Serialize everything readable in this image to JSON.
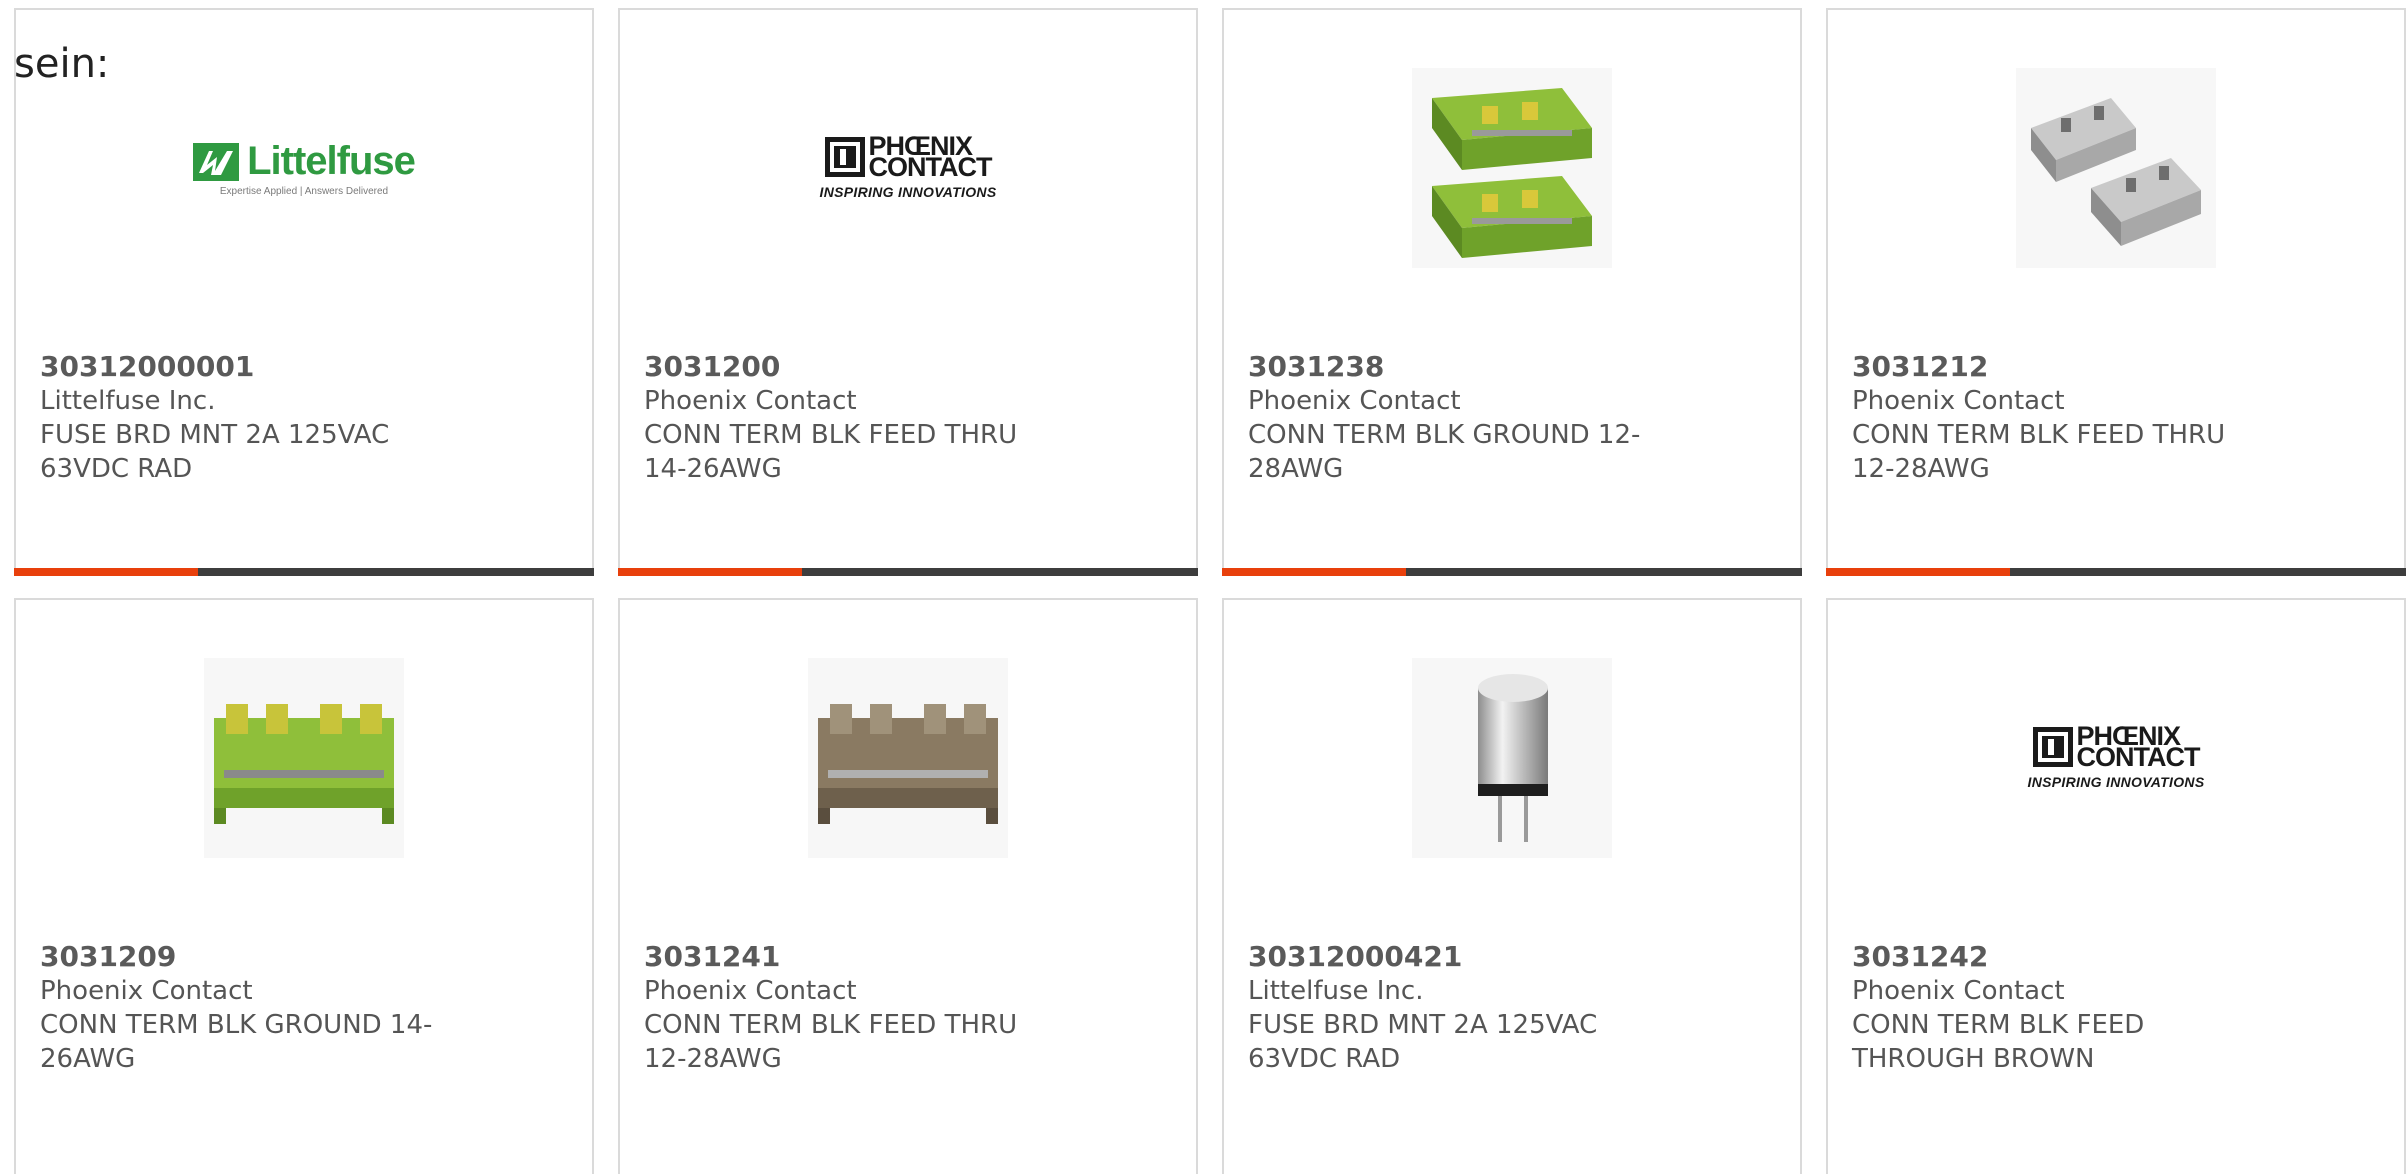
{
  "intro_text": "sein:",
  "colors": {
    "card_border": "#dadada",
    "bar_dark": "#3d3d3d",
    "bar_accent": "#e8400c",
    "littelfuse_green": "#2f9a41",
    "phoenix_black": "#1a1a1a"
  },
  "logos": {
    "littelfuse": {
      "name": "Littelfuse",
      "tagline": "Expertise Applied | Answers Delivered"
    },
    "phoenix": {
      "line1": "PHŒNIX",
      "line2": "CONTACT",
      "tagline": "INSPIRING INNOVATIONS"
    }
  },
  "products": [
    {
      "part_number": "30312000001",
      "manufacturer": "Littelfuse Inc.",
      "description": "FUSE BRD MNT 2A 125VAC 63VDC RAD",
      "image": "littelfuse-logo"
    },
    {
      "part_number": "3031200",
      "manufacturer": "Phoenix Contact",
      "description": "CONN TERM BLK FEED THRU 14-26AWG",
      "image": "phoenix-contact-logo"
    },
    {
      "part_number": "3031238",
      "manufacturer": "Phoenix Contact",
      "description": "CONN TERM BLK GROUND 12-28AWG",
      "image": "green-yellow-terminal-block-pair"
    },
    {
      "part_number": "3031212",
      "manufacturer": "Phoenix Contact",
      "description": "CONN TERM BLK FEED THRU 12-28AWG",
      "image": "grey-terminal-block-pair"
    },
    {
      "part_number": "3031209",
      "manufacturer": "Phoenix Contact",
      "description": "CONN TERM BLK GROUND 14-26AWG",
      "image": "green-yellow-terminal-block"
    },
    {
      "part_number": "3031241",
      "manufacturer": "Phoenix Contact",
      "description": "CONN TERM BLK FEED THRU 12-28AWG",
      "image": "brown-terminal-block"
    },
    {
      "part_number": "30312000421",
      "manufacturer": "Littelfuse Inc.",
      "description": "FUSE BRD MNT 2A 125VAC 63VDC RAD",
      "image": "radial-fuse"
    },
    {
      "part_number": "3031242",
      "manufacturer": "Phoenix Contact",
      "description": "CONN TERM BLK FEED THROUGH BROWN",
      "image": "phoenix-contact-logo"
    }
  ]
}
